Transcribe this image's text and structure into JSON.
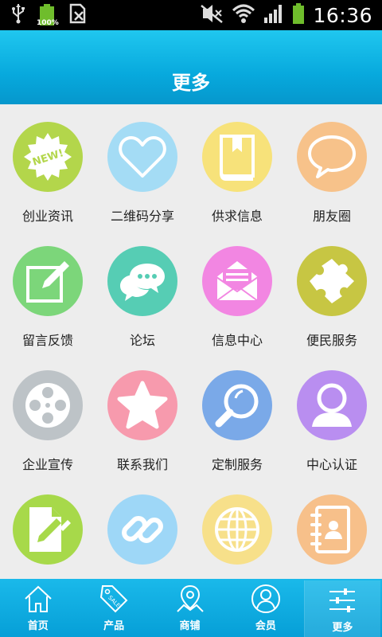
{
  "status_bar": {
    "time": "16:36",
    "battery_percent": "100%",
    "icons": [
      "usb-icon",
      "battery-full-icon",
      "sim-icon",
      "mute-icon",
      "wifi-icon",
      "signal-icon",
      "battery-icon"
    ]
  },
  "header": {
    "title": "更多"
  },
  "grid": {
    "items": [
      {
        "label": "创业资讯",
        "icon": "new-badge-icon",
        "color": "#b3d64b"
      },
      {
        "label": "二维码分享",
        "icon": "heart-icon",
        "color": "#a4dcf5"
      },
      {
        "label": "供求信息",
        "icon": "book-icon",
        "color": "#f7e27a"
      },
      {
        "label": "朋友圈",
        "icon": "speech-bubble-icon",
        "color": "#f7c28a"
      },
      {
        "label": "留言反馈",
        "icon": "edit-icon",
        "color": "#7cd67a"
      },
      {
        "label": "论坛",
        "icon": "chat-bubbles-icon",
        "color": "#56cdb4"
      },
      {
        "label": "信息中心",
        "icon": "envelope-icon",
        "color": "#f286e2"
      },
      {
        "label": "便民服务",
        "icon": "puzzle-icon",
        "color": "#c7c643"
      },
      {
        "label": "企业宣传",
        "icon": "film-reel-icon",
        "color": "#bdc3c7"
      },
      {
        "label": "联系我们",
        "icon": "star-icon",
        "color": "#f79aad"
      },
      {
        "label": "定制服务",
        "icon": "magnifier-icon",
        "color": "#7aa9e8"
      },
      {
        "label": "中心认证",
        "icon": "user-icon",
        "color": "#b98ef0"
      },
      {
        "label": "",
        "icon": "document-edit-icon",
        "color": "#a7d94a"
      },
      {
        "label": "",
        "icon": "link-icon",
        "color": "#9ed7f7"
      },
      {
        "label": "",
        "icon": "globe-icon",
        "color": "#f7e08a"
      },
      {
        "label": "",
        "icon": "contacts-book-icon",
        "color": "#f7c08a"
      }
    ]
  },
  "bottom_nav": {
    "items": [
      {
        "label": "首页",
        "icon": "home-icon"
      },
      {
        "label": "产品",
        "icon": "sale-tag-icon"
      },
      {
        "label": "商铺",
        "icon": "map-pin-icon"
      },
      {
        "label": "会员",
        "icon": "member-icon"
      },
      {
        "label": "更多",
        "icon": "sliders-icon"
      }
    ],
    "active_index": 4
  }
}
